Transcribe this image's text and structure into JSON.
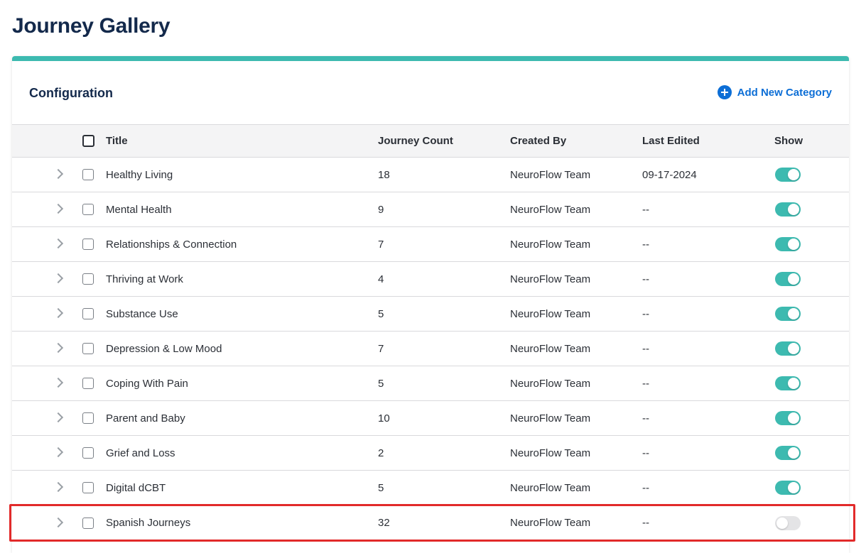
{
  "page": {
    "title": "Journey Gallery"
  },
  "card": {
    "title": "Configuration",
    "add_label": "Add New Category"
  },
  "table": {
    "headers": {
      "title": "Title",
      "count": "Journey Count",
      "created": "Created By",
      "edited": "Last Edited",
      "show": "Show"
    },
    "rows": [
      {
        "title": "Healthy Living",
        "count": "18",
        "created": "NeuroFlow Team",
        "edited": "09-17-2024",
        "show": true
      },
      {
        "title": "Mental Health",
        "count": "9",
        "created": "NeuroFlow Team",
        "edited": "--",
        "show": true
      },
      {
        "title": "Relationships & Connection",
        "count": "7",
        "created": "NeuroFlow Team",
        "edited": "--",
        "show": true
      },
      {
        "title": "Thriving at Work",
        "count": "4",
        "created": "NeuroFlow Team",
        "edited": "--",
        "show": true
      },
      {
        "title": "Substance Use",
        "count": "5",
        "created": "NeuroFlow Team",
        "edited": "--",
        "show": true
      },
      {
        "title": "Depression & Low Mood",
        "count": "7",
        "created": "NeuroFlow Team",
        "edited": "--",
        "show": true
      },
      {
        "title": "Coping With Pain",
        "count": "5",
        "created": "NeuroFlow Team",
        "edited": "--",
        "show": true
      },
      {
        "title": "Parent and Baby",
        "count": "10",
        "created": "NeuroFlow Team",
        "edited": "--",
        "show": true
      },
      {
        "title": "Grief and Loss",
        "count": "2",
        "created": "NeuroFlow Team",
        "edited": "--",
        "show": true
      },
      {
        "title": "Digital dCBT",
        "count": "5",
        "created": "NeuroFlow Team",
        "edited": "--",
        "show": true
      },
      {
        "title": "Spanish Journeys",
        "count": "32",
        "created": "NeuroFlow Team",
        "edited": "--",
        "show": false
      }
    ]
  },
  "colors": {
    "accent": "#3dbab0",
    "link": "#0c6ed6",
    "heading": "#13294b",
    "highlight": "#e22a2a"
  },
  "icons": {
    "add": "plus-circle-icon",
    "expand": "chevron-right-icon"
  }
}
